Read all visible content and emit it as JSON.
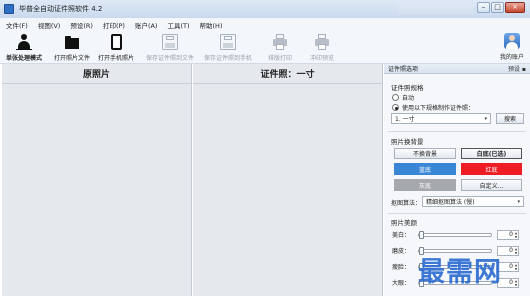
{
  "window": {
    "title": "毕普全自动证件照软件 4.2",
    "controls": [
      "–",
      "□",
      "×"
    ]
  },
  "menu": [
    "文件(F)",
    "视图(V)",
    "预设(R)",
    "打印(P)",
    "账户(A)",
    "工具(T)",
    "帮助(H)"
  ],
  "toolbar": {
    "single_mode": "单张处理模式",
    "open_photo": "打开照片文件",
    "open_phone": "打开手机照片",
    "save_file": "保存证件照到文件",
    "save_phone": "保存证件照到手机",
    "layout_print": "排版打印",
    "print_preview": "冲印预览",
    "account": "我的账户"
  },
  "panes": {
    "original_title": "原照片",
    "id_photo_title": "证件照：一寸"
  },
  "panel": {
    "title": "证件照选项",
    "pin": "预设 ▪",
    "spec_section": "证件照规格",
    "auto_label": "自动",
    "use_spec_label": "使用以下规格制作证件照：",
    "spec_value": "1. 一寸",
    "search_button": "搜索",
    "bg_section": "照片换背景",
    "no_change_button": "不换背景",
    "white_bg": "白底(已选)",
    "blue_bg": "蓝底",
    "red_bg": "红底",
    "gray_bg": "灰底",
    "custom_bg": "自定义...",
    "matting_label": "抠图算法：",
    "matting_value": "精细抠图算法 (慢)",
    "beauty_section": "照片美颜",
    "sliders": [
      {
        "label": "美白：",
        "value": "0"
      },
      {
        "label": "磨皮：",
        "value": "0"
      },
      {
        "label": "瘦脸：",
        "value": "0"
      },
      {
        "label": "大眼：",
        "value": "0"
      }
    ]
  },
  "colors": {
    "blue_swatch": "#3a86d6",
    "red_swatch": "#ee1c24",
    "gray_swatch": "#a5a9ae",
    "watermark": "#2a6bd1"
  },
  "watermark": "最需网",
  "icons": [
    "person-icon",
    "folder-icon",
    "phone-icon",
    "save-icon",
    "save-phone-icon",
    "printer-icon",
    "print-preview-icon",
    "user-avatar-icon"
  ]
}
